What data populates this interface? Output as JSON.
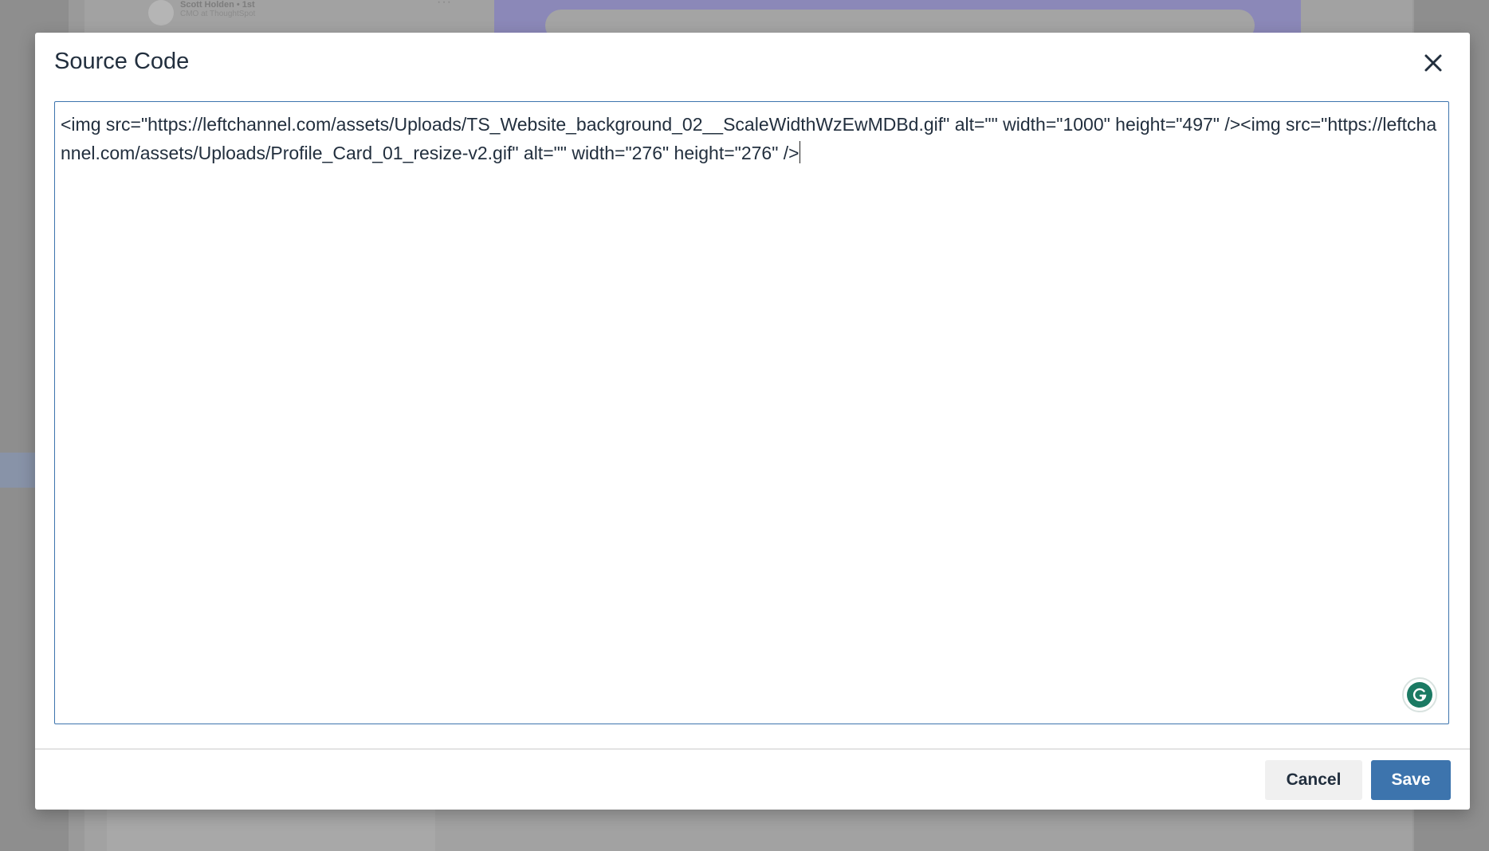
{
  "background": {
    "profile_name": "Scott Holden • 1st",
    "profile_role": "CMO at ThoughtSpot",
    "more_label": "···"
  },
  "modal": {
    "title": "Source Code",
    "source_code": "<img src=\"https://leftchannel.com/assets/Uploads/TS_Website_background_02__ScaleWidthWzEwMDBd.gif\" alt=\"\" width=\"1000\" height=\"497\" /><img src=\"https://leftchannel.com/assets/Uploads/Profile_Card_01_resize-v2.gif\" alt=\"\" width=\"276\" height=\"276\" />",
    "cancel_label": "Cancel",
    "save_label": "Save"
  },
  "colors": {
    "accent": "#3d74ad",
    "text": "#222f3e",
    "grammarly": "#1b7a63"
  },
  "icons": {
    "close": "close-icon",
    "grammarly": "grammarly-icon"
  }
}
